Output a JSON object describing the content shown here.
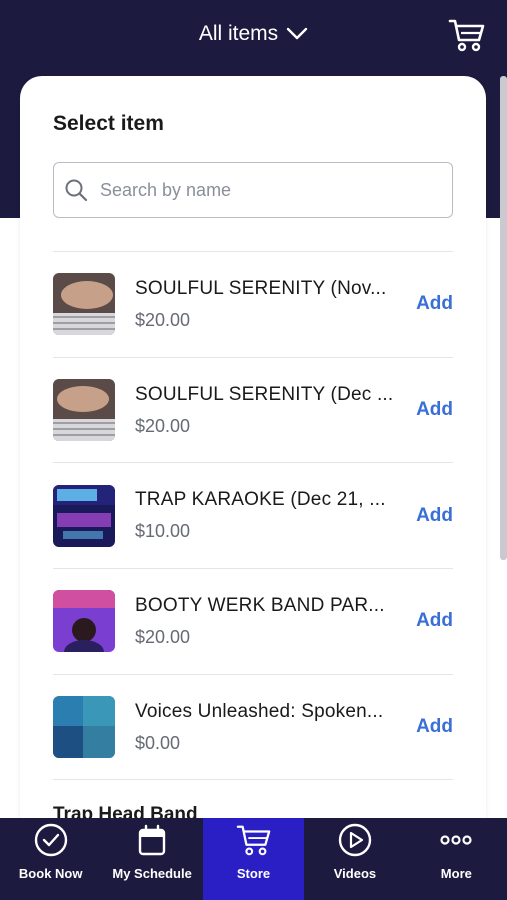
{
  "header": {
    "title": "All items",
    "dropdown_icon": "chevron-down-icon",
    "cart_icon": "cart-icon"
  },
  "panel": {
    "title": "Select item",
    "search_placeholder": "Search by name"
  },
  "items": [
    {
      "name": "SOULFUL SERENITY (Nov...",
      "price": "$20.00",
      "action": "Add",
      "thumb_colors": [
        "#8a6a5a",
        "#c7a08a",
        "#4a4a55"
      ]
    },
    {
      "name": "SOULFUL SERENITY (Dec ...",
      "price": "$20.00",
      "action": "Add",
      "thumb_colors": [
        "#8a6a5a",
        "#c7a08a",
        "#4a4a55"
      ]
    },
    {
      "name": "TRAP KARAOKE (Dec 21, ...",
      "price": "$10.00",
      "action": "Add",
      "thumb_colors": [
        "#1a1a5a",
        "#6ad1ff",
        "#b24dd9"
      ]
    },
    {
      "name": "BOOTY WERK BAND PAR...",
      "price": "$20.00",
      "action": "Add",
      "thumb_colors": [
        "#7a3fd0",
        "#d04fa0",
        "#2a2060"
      ]
    },
    {
      "name": "Voices Unleashed: Spoken...",
      "price": "$0.00",
      "action": "Add",
      "thumb_colors": [
        "#2a7fb0",
        "#4ab0c0",
        "#1a3a70"
      ]
    }
  ],
  "partial_item": "Trap Head Band",
  "tabs": [
    {
      "label": "Book Now",
      "icon": "check-circle-icon",
      "active": false
    },
    {
      "label": "My Schedule",
      "icon": "calendar-icon",
      "active": false
    },
    {
      "label": "Store",
      "icon": "cart-icon",
      "active": true
    },
    {
      "label": "Videos",
      "icon": "play-circle-icon",
      "active": false
    },
    {
      "label": "More",
      "icon": "more-dots-icon",
      "active": false
    }
  ],
  "colors": {
    "navy": "#1c1a3e",
    "active_tab": "#2a1fc4",
    "link_blue": "#3a6fd8"
  }
}
